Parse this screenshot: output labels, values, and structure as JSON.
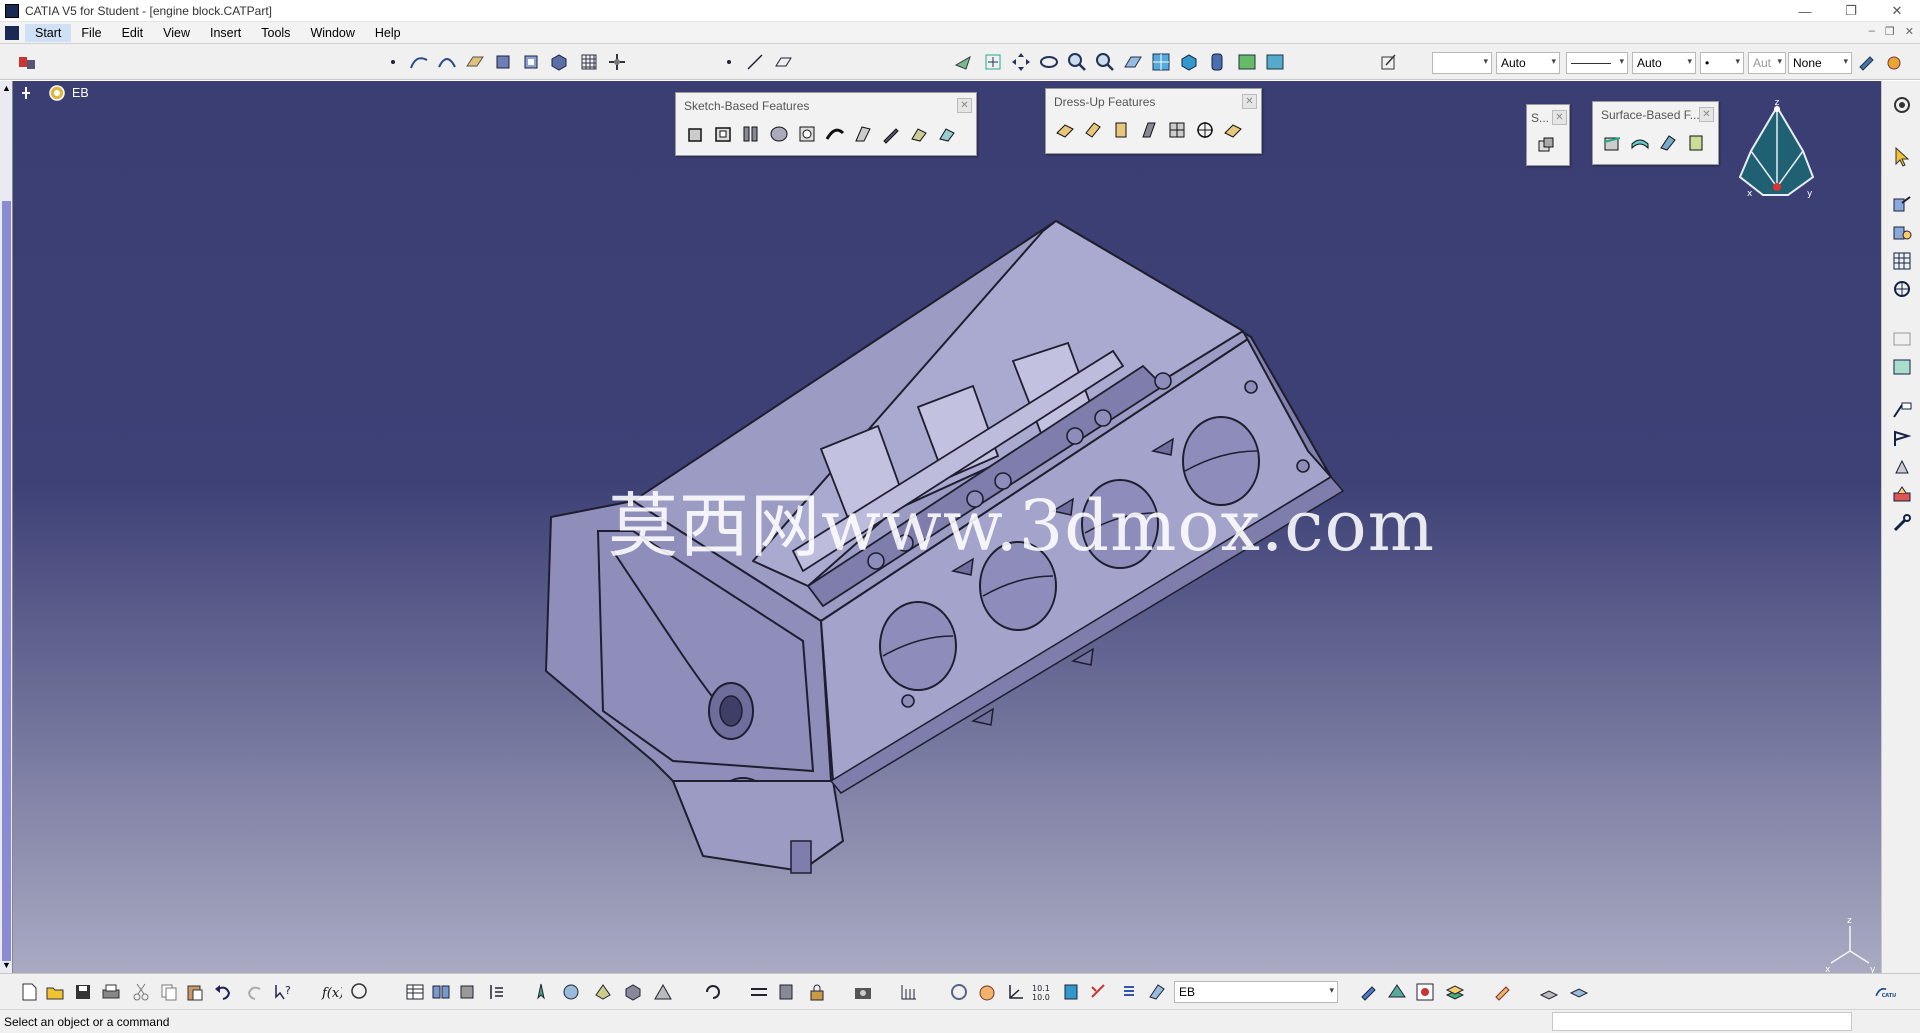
{
  "window": {
    "title": "CATIA V5 for Student - [engine block.CATPart]",
    "controls": [
      "—",
      "❐",
      "✕"
    ]
  },
  "menu": {
    "items": [
      "Start",
      "File",
      "Edit",
      "View",
      "Insert",
      "Tools",
      "Window",
      "Help"
    ],
    "mdi_controls": [
      "–",
      "❐",
      "✕"
    ]
  },
  "toolbar": {
    "line_weight_value": "Auto",
    "line_type_value": "Auto",
    "point_value": "•",
    "layer_value": "Aut",
    "rendering_value": "None"
  },
  "tree": {
    "root_label": "EB"
  },
  "panels": {
    "sketch_based_title": "Sketch-Based Features",
    "dress_up_title": "Dress-Up Features",
    "small_panel_title": "S...",
    "surface_based_title": "Surface-Based F..."
  },
  "watermark": "莫西网www.3dmox.com",
  "compass_axes": [
    "z",
    "x",
    "y"
  ],
  "bottom": {
    "current_body": "EB"
  },
  "status": {
    "message": "Select an object or a command"
  },
  "colors": {
    "viewport_top": "#3a3e72",
    "viewport_bottom": "#a9aac2",
    "part_fill": "#9c9bc4",
    "part_edge": "#1e1e2e",
    "compass": "#1f6073"
  }
}
